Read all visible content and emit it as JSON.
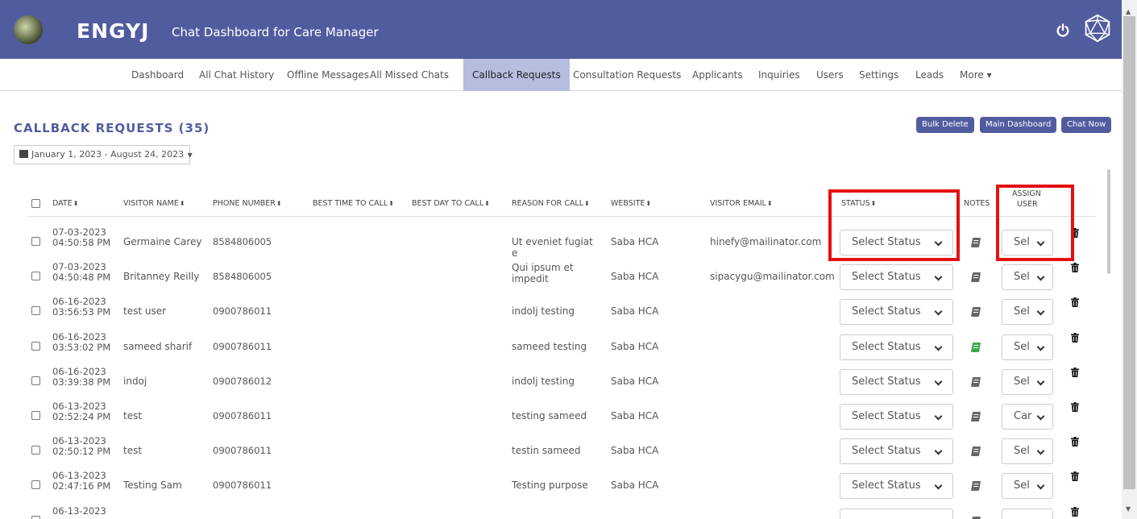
{
  "header": {
    "brand": "ENGYJ",
    "subtitle": "Chat Dashboard for Care Manager",
    "bg_color": "#515c9f"
  },
  "nav": {
    "items": [
      {
        "label": "Dashboard"
      },
      {
        "label": "All Chat History"
      },
      {
        "label": "Offline Messages"
      },
      {
        "label": "All Missed Chats"
      },
      {
        "label": "Callback Requests",
        "active": true
      },
      {
        "label": "Consultation Requests"
      },
      {
        "label": "Applicants"
      },
      {
        "label": "Inquiries"
      },
      {
        "label": "Users"
      },
      {
        "label": "Settings"
      },
      {
        "label": "Leads"
      },
      {
        "label": "More ▾"
      }
    ]
  },
  "page": {
    "title": "CALLBACK REQUESTS (35)",
    "date_range": "January 1, 2023 - August 24, 2023",
    "buttons": {
      "bulk_delete": "Bulk Delete",
      "main_dashboard": "Main Dashboard",
      "chat_now": "Chat Now"
    }
  },
  "table": {
    "headers": {
      "date": "DATE",
      "visitor_name": "VISITOR NAME",
      "phone": "PHONE NUMBER",
      "best_time": "BEST TIME TO CALL",
      "best_day": "BEST DAY TO CALL",
      "reason": "REASON FOR CALL",
      "website": "WEBSITE",
      "email": "VISITOR EMAIL",
      "status": "STATUS",
      "notes": "NOTES",
      "assign_user_1": "ASSIGN",
      "assign_user_2": "USER"
    },
    "rows": [
      {
        "date": "07-03-2023",
        "time": "04:50:58 PM",
        "name": "Germaine Carey",
        "phone": "8584806005",
        "reason": "Ut eveniet fugiat e",
        "website": "Saba HCA",
        "email": "hinefy@mailinator.com",
        "status": "Select Status",
        "user": "Sel",
        "note_green": false
      },
      {
        "date": "07-03-2023",
        "time": "04:50:48 PM",
        "name": "Britanney Reilly",
        "phone": "8584806005",
        "reason": "Qui ipsum et impedit",
        "website": "Saba HCA",
        "email": "sipacygu@mailinator.com",
        "status": "Select Status",
        "user": "Sel",
        "note_green": false
      },
      {
        "date": "06-16-2023",
        "time": "03:56:53 PM",
        "name": "test user",
        "phone": "0900786011",
        "reason": "indolj testing",
        "website": "Saba HCA",
        "email": "",
        "status": "Select Status",
        "user": "Sel",
        "note_green": false
      },
      {
        "date": "06-16-2023",
        "time": "03:53:02 PM",
        "name": "sameed sharif",
        "phone": "0900786011",
        "reason": "sameed testing",
        "website": "Saba HCA",
        "email": "",
        "status": "Select Status",
        "user": "Sel",
        "note_green": true
      },
      {
        "date": "06-16-2023",
        "time": "03:39:38 PM",
        "name": "indoj",
        "phone": "0900786012",
        "reason": "indolj testing",
        "website": "Saba HCA",
        "email": "",
        "status": "Select Status",
        "user": "Sel",
        "note_green": false
      },
      {
        "date": "06-13-2023",
        "time": "02:52:24 PM",
        "name": "test",
        "phone": "0900786011",
        "reason": "testing sameed",
        "website": "Saba HCA",
        "email": "",
        "status": "Select Status",
        "user": "Car",
        "note_green": false
      },
      {
        "date": "06-13-2023",
        "time": "02:50:12 PM",
        "name": "test",
        "phone": "0900786011",
        "reason": "testin sameed",
        "website": "Saba HCA",
        "email": "",
        "status": "Select Status",
        "user": "Sel",
        "note_green": false
      },
      {
        "date": "06-13-2023",
        "time": "02:47:16 PM",
        "name": "Testing Sam",
        "phone": "0900786011",
        "reason": "Testing purpose",
        "website": "Saba HCA",
        "email": "",
        "status": "Select Status",
        "user": "Sel",
        "note_green": false
      },
      {
        "date": "06-13-2023",
        "time": "",
        "name": "",
        "phone": "",
        "reason": "",
        "website": "",
        "email": "",
        "status": "",
        "user": "",
        "note_green": false
      }
    ]
  },
  "colors": {
    "accent": "#515c9f",
    "nav_active": "#b7bddf",
    "highlight": "#e41010",
    "note_green": "#3da84a"
  }
}
